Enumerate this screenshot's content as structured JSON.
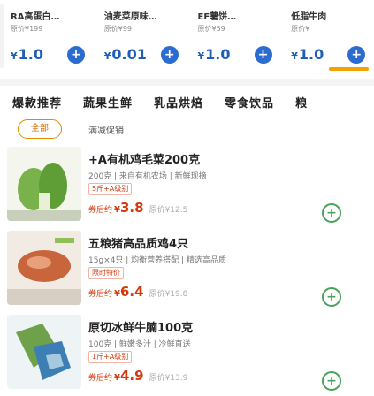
{
  "deals": [
    {
      "name": "RA高蛋白…",
      "orig": "原价¥199",
      "price": "1.0"
    },
    {
      "name": "油麦菜原味…",
      "orig": "原价¥99",
      "price": "0.01"
    },
    {
      "name": "EF薯饼…",
      "orig": "原价¥59",
      "price": "1.0"
    },
    {
      "name": "低脂牛肉",
      "orig": "原价¥",
      "price": "1.0"
    }
  ],
  "currency": "¥",
  "plus_symbol": "+",
  "tabs": [
    "爆款推荐",
    "蔬果生鲜",
    "乳品烘焙",
    "零食饮品",
    "粮"
  ],
  "filters": {
    "active": "全部",
    "second": "满减促销"
  },
  "products": [
    {
      "title": "+A有机鸡毛菜200克",
      "spec": "200克 | 来自有机农场 | 新鲜现摘",
      "tag": "5斤+A级别",
      "price_label": "券后约",
      "price": "3.8",
      "orig": "原价¥12.5",
      "icon": "vegetable-image"
    },
    {
      "title": "五粮猪高品质鸡4只",
      "spec": "15g×4只 | 均衡营养搭配 | 精选高品质",
      "tag": "限时特价",
      "price_label": "券后约",
      "price": "6.4",
      "orig": "原价¥19.8",
      "icon": "meat-image"
    },
    {
      "title": "原切冰鲜牛腩100克",
      "spec": "100克 | 鲜嫩多汁 | 冷鲜直送",
      "tag": "1斤+A级别",
      "price_label": "券后约",
      "price": "4.9",
      "orig": "原价¥13.9",
      "icon": "fish-image"
    }
  ],
  "colors": {
    "deal_price": "#1f5eb8",
    "accent_orange": "#f2a200",
    "price_red": "#d4380d",
    "add_green": "#4aa35a"
  }
}
